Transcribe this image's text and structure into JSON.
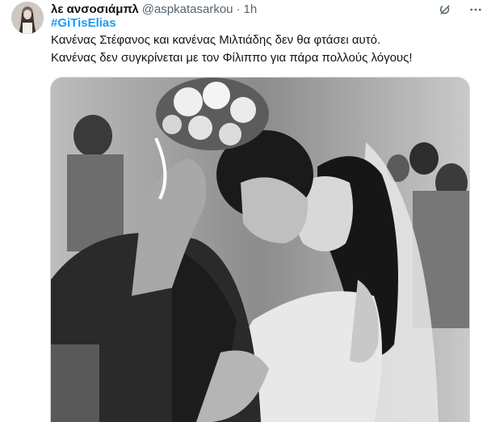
{
  "tweet": {
    "author_name": "λε ανσοσιάμπλ",
    "handle": "@aspkatasarkou",
    "separator": "·",
    "time": "1h",
    "hashtag": "#GiTisElias",
    "text_line_1": "Κανένας Στέφανος και κανένας Μιλτιάδης δεν θα φτάσει αυτό.",
    "text_line_2": "Κανένας δεν συγκρίνεται με τον Φίλιππο για πάρα πολλούς λόγους!"
  },
  "icons": {
    "avatar": "profile-photo",
    "grok": "grok-icon",
    "more": "more-options-icon"
  },
  "colors": {
    "hashtag": "#1d9bf0",
    "secondary_text": "#536471",
    "primary_text": "#0f1419"
  }
}
